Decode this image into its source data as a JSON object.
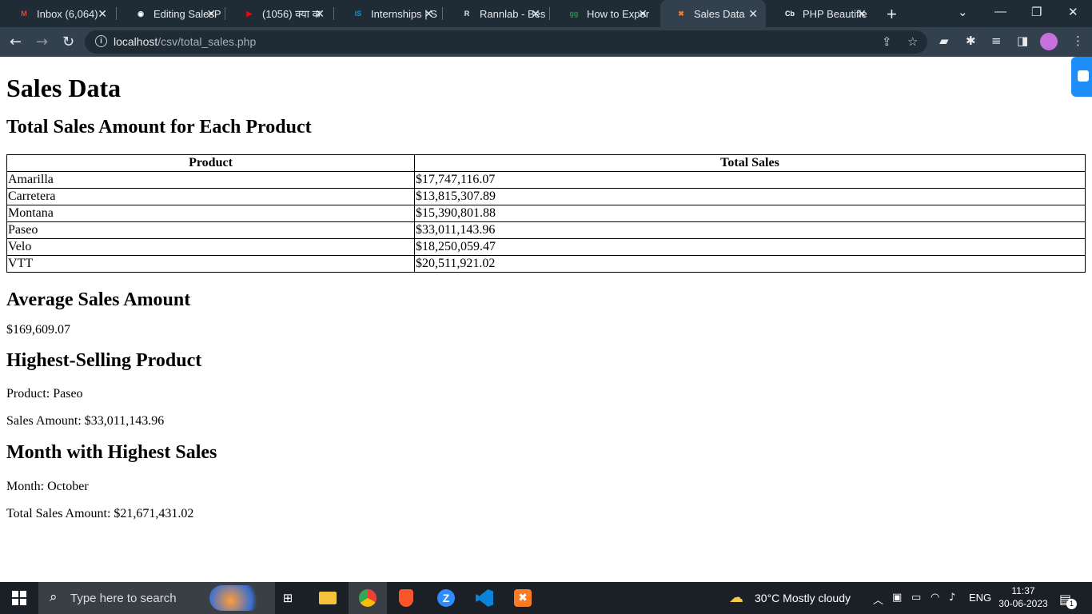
{
  "browser": {
    "tabs": [
      {
        "title": "Inbox (6,064)",
        "icon": "gmail-icon",
        "color": "#ea4335",
        "glyph": "M"
      },
      {
        "title": "Editing SalesP",
        "icon": "github-icon",
        "color": "#ffffff",
        "glyph": "◉"
      },
      {
        "title": "(1056) क्या क",
        "icon": "youtube-icon",
        "color": "#ff0000",
        "glyph": "▶"
      },
      {
        "title": "Internships | S",
        "icon": "internshala-icon",
        "color": "#1295d8",
        "glyph": "IS"
      },
      {
        "title": "Rannlab - Bes",
        "icon": "rannlab-icon",
        "color": "#e8eaed",
        "glyph": "R"
      },
      {
        "title": "How to Expor",
        "icon": "geeksforgeeks-icon",
        "color": "#2f8d46",
        "glyph": "gg"
      },
      {
        "title": "Sales Data",
        "icon": "xampp-icon",
        "color": "#fb7a24",
        "glyph": "✖"
      },
      {
        "title": "PHP Beautifie",
        "icon": "codebeautify-icon",
        "color": "#ffffff",
        "glyph": "Cb"
      }
    ],
    "active_tab": 6,
    "url_host": "localhost",
    "url_path": "/csv/total_sales.php"
  },
  "page": {
    "title": "Sales Data",
    "section_total": "Total Sales Amount for Each Product",
    "table": {
      "headers": [
        "Product",
        "Total Sales"
      ],
      "rows": [
        [
          "Amarilla",
          "$17,747,116.07"
        ],
        [
          "Carretera",
          "$13,815,307.89"
        ],
        [
          "Montana",
          "$15,390,801.88"
        ],
        [
          "Paseo",
          "$33,011,143.96"
        ],
        [
          "Velo",
          "$18,250,059.47"
        ],
        [
          "VTT",
          "$20,511,921.02"
        ]
      ]
    },
    "section_average": "Average Sales Amount",
    "average_value": "$169,609.07",
    "section_highest": "Highest-Selling Product",
    "highest_product": "Product: Paseo",
    "highest_amount": "Sales Amount: $33,011,143.96",
    "section_month": "Month with Highest Sales",
    "month_value": "Month: October",
    "month_amount": "Total Sales Amount: $21,671,431.02"
  },
  "taskbar": {
    "search_placeholder": "Type here to search",
    "weather": "30°C  Mostly cloudy",
    "language": "ENG",
    "time": "11:37",
    "date": "30-06-2023",
    "notifications": "1"
  }
}
